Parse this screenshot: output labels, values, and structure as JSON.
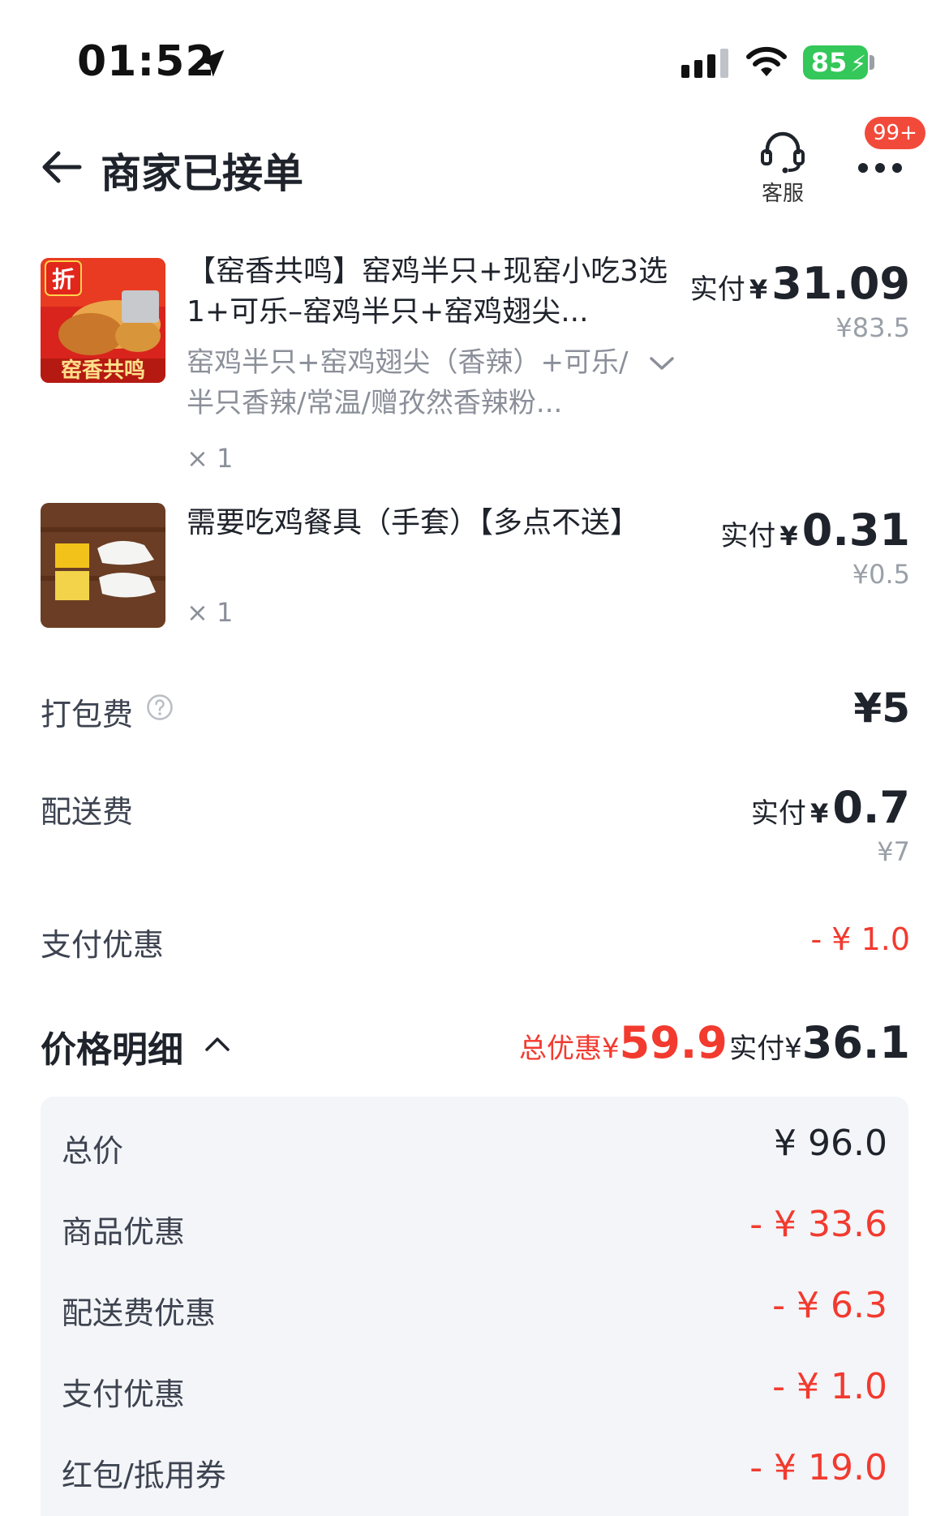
{
  "status_bar": {
    "time": "01:52",
    "battery": "85",
    "icons": [
      "location-arrow-icon",
      "signal-icon",
      "wifi-icon",
      "battery-charging-icon"
    ]
  },
  "nav": {
    "title": "商家已接单",
    "customer_service_label": "客服",
    "badge": "99+",
    "icons": [
      "back-arrow-icon",
      "headset-icon",
      "more-icon"
    ]
  },
  "items": [
    {
      "thumb_tag": "折",
      "thumb_caption": "窑香共鸣",
      "title": "【窑香共鸣】窑鸡半只+现窑小吃3选1+可乐–窑鸡半只+窑鸡翅尖...",
      "spec": "窑鸡半只+窑鸡翅尖（香辣）+可乐/半只香辣/常温/赠孜然香辣粉...",
      "qty": "× 1",
      "paid_label": "实付",
      "yen": "¥",
      "paid_value": "31.09",
      "original_price": "¥83.5"
    },
    {
      "title": "需要吃鸡餐具（手套）【多点不送】",
      "qty": "× 1",
      "paid_label": "实付",
      "yen": "¥",
      "paid_value": "0.31",
      "original_price": "¥0.5"
    }
  ],
  "fees": {
    "packing_label": "打包费",
    "packing_value": "¥5",
    "delivery_label": "配送费",
    "delivery_paid_label": "实付",
    "delivery_yen": "¥",
    "delivery_paid_value": "0.7",
    "delivery_original": "¥7",
    "payment_discount_label": "支付优惠",
    "payment_discount_value": "- ¥ 1.0"
  },
  "price_detail": {
    "title": "价格明细",
    "total_discount_label": "总优惠",
    "yen": "¥",
    "total_discount_value": "59.9",
    "paid_label": "实付",
    "paid_value": "36.1",
    "rows": [
      {
        "label": "总价",
        "value": "¥ 96.0"
      },
      {
        "label": "商品优惠",
        "value": "- ¥ 33.6"
      },
      {
        "label": "配送费优惠",
        "value": "- ¥ 6.3"
      },
      {
        "label": "支付优惠",
        "value": "- ¥ 1.0"
      },
      {
        "label": "红包/抵用券",
        "value": "- ¥ 19.0"
      }
    ]
  },
  "colors": {
    "text": "#1f232b",
    "muted": "#8b8f99",
    "discount_red": "#f23a2f",
    "panel_bg": "#f3f5f8",
    "battery_green": "#34c759",
    "badge_red": "#f24a3a"
  }
}
